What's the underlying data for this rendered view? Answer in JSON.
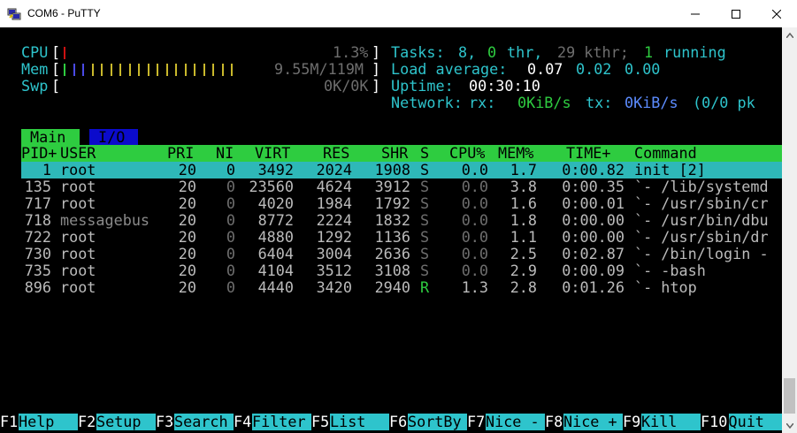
{
  "window": {
    "title": "COM6 - PuTTY",
    "icon": "putty-icon"
  },
  "meters": {
    "cpu_label": "CPU",
    "cpu_value": "1.3%",
    "mem_label": "Mem",
    "mem_value": "9.55M/119M",
    "swp_label": "Swp",
    "swp_value": "0K/0K"
  },
  "summary": {
    "tasks_label": "Tasks:",
    "tasks_count": "8,",
    "thr_count": "0",
    "thr_label": "thr,",
    "kthr": "29 kthr;",
    "running_count": "1",
    "running_label": "running",
    "load_label": "Load average:",
    "load1": "0.07",
    "load5": "0.02",
    "load15": "0.00",
    "uptime_label": "Uptime:",
    "uptime_value": "00:30:10",
    "network_label": "Network:",
    "rx_label": "rx:",
    "rx_value": "0KiB/s",
    "tx_label": "tx:",
    "tx_value": "0KiB/s",
    "pk_value": "(0/0 pk"
  },
  "tabs": {
    "main": "Main",
    "io": "I/O"
  },
  "columns": {
    "pid": "PID+",
    "user": "USER",
    "pri": "PRI",
    "ni": "NI",
    "virt": "VIRT",
    "res": "RES",
    "shr": "SHR",
    "s": "S",
    "cpu": "CPU%",
    "mem": "MEM%",
    "time": "TIME+",
    "command": "Command"
  },
  "processes": [
    {
      "pid": "1",
      "user": "root",
      "pri": "20",
      "ni": "0",
      "virt": "3492",
      "res": "2024",
      "shr": "1908",
      "s": "S",
      "cpu": "0.0",
      "mem": "1.7",
      "time": "0:00.82",
      "command": "init [2]"
    },
    {
      "pid": "135",
      "user": "root",
      "pri": "20",
      "ni": "0",
      "virt": "23560",
      "res": "4624",
      "shr": "3912",
      "s": "S",
      "cpu": "0.0",
      "mem": "3.8",
      "time": "0:00.35",
      "command": "`- /lib/systemd"
    },
    {
      "pid": "717",
      "user": "root",
      "pri": "20",
      "ni": "0",
      "virt": "4020",
      "res": "1984",
      "shr": "1792",
      "s": "S",
      "cpu": "0.0",
      "mem": "1.6",
      "time": "0:00.01",
      "command": "`- /usr/sbin/cr"
    },
    {
      "pid": "718",
      "user": "messagebus",
      "pri": "20",
      "ni": "0",
      "virt": "8772",
      "res": "2224",
      "shr": "1832",
      "s": "S",
      "cpu": "0.0",
      "mem": "1.8",
      "time": "0:00.00",
      "command": "`- /usr/bin/dbu"
    },
    {
      "pid": "722",
      "user": "root",
      "pri": "20",
      "ni": "0",
      "virt": "4880",
      "res": "1292",
      "shr": "1136",
      "s": "S",
      "cpu": "0.0",
      "mem": "1.1",
      "time": "0:00.00",
      "command": "`- /usr/sbin/dr"
    },
    {
      "pid": "730",
      "user": "root",
      "pri": "20",
      "ni": "0",
      "virt": "6404",
      "res": "3004",
      "shr": "2636",
      "s": "S",
      "cpu": "0.0",
      "mem": "2.5",
      "time": "0:02.87",
      "command": "`- /bin/login -"
    },
    {
      "pid": "735",
      "user": "root",
      "pri": "20",
      "ni": "0",
      "virt": "4104",
      "res": "3512",
      "shr": "3108",
      "s": "S",
      "cpu": "0.0",
      "mem": "2.9",
      "time": "0:00.09",
      "command": "`- -bash"
    },
    {
      "pid": "896",
      "user": "root",
      "pri": "20",
      "ni": "0",
      "virt": "4440",
      "res": "3420",
      "shr": "2940",
      "s": "R",
      "cpu": "1.3",
      "mem": "2.8",
      "time": "0:01.26",
      "command": "`- htop"
    }
  ],
  "fkeys": [
    {
      "key": "F1",
      "label": "Help"
    },
    {
      "key": "F2",
      "label": "Setup"
    },
    {
      "key": "F3",
      "label": "Search"
    },
    {
      "key": "F4",
      "label": "Filter"
    },
    {
      "key": "F5",
      "label": "List"
    },
    {
      "key": "F6",
      "label": "SortBy"
    },
    {
      "key": "F7",
      "label": "Nice -"
    },
    {
      "key": "F8",
      "label": "Nice +"
    },
    {
      "key": "F9",
      "label": "Kill"
    },
    {
      "key": "F10",
      "label": "Quit"
    }
  ],
  "colors": {
    "accent_green": "#2ecc40",
    "accent_cyan": "#2ec4cc",
    "io_blue": "#0b0bcc",
    "terminal_bg": "#000000"
  }
}
